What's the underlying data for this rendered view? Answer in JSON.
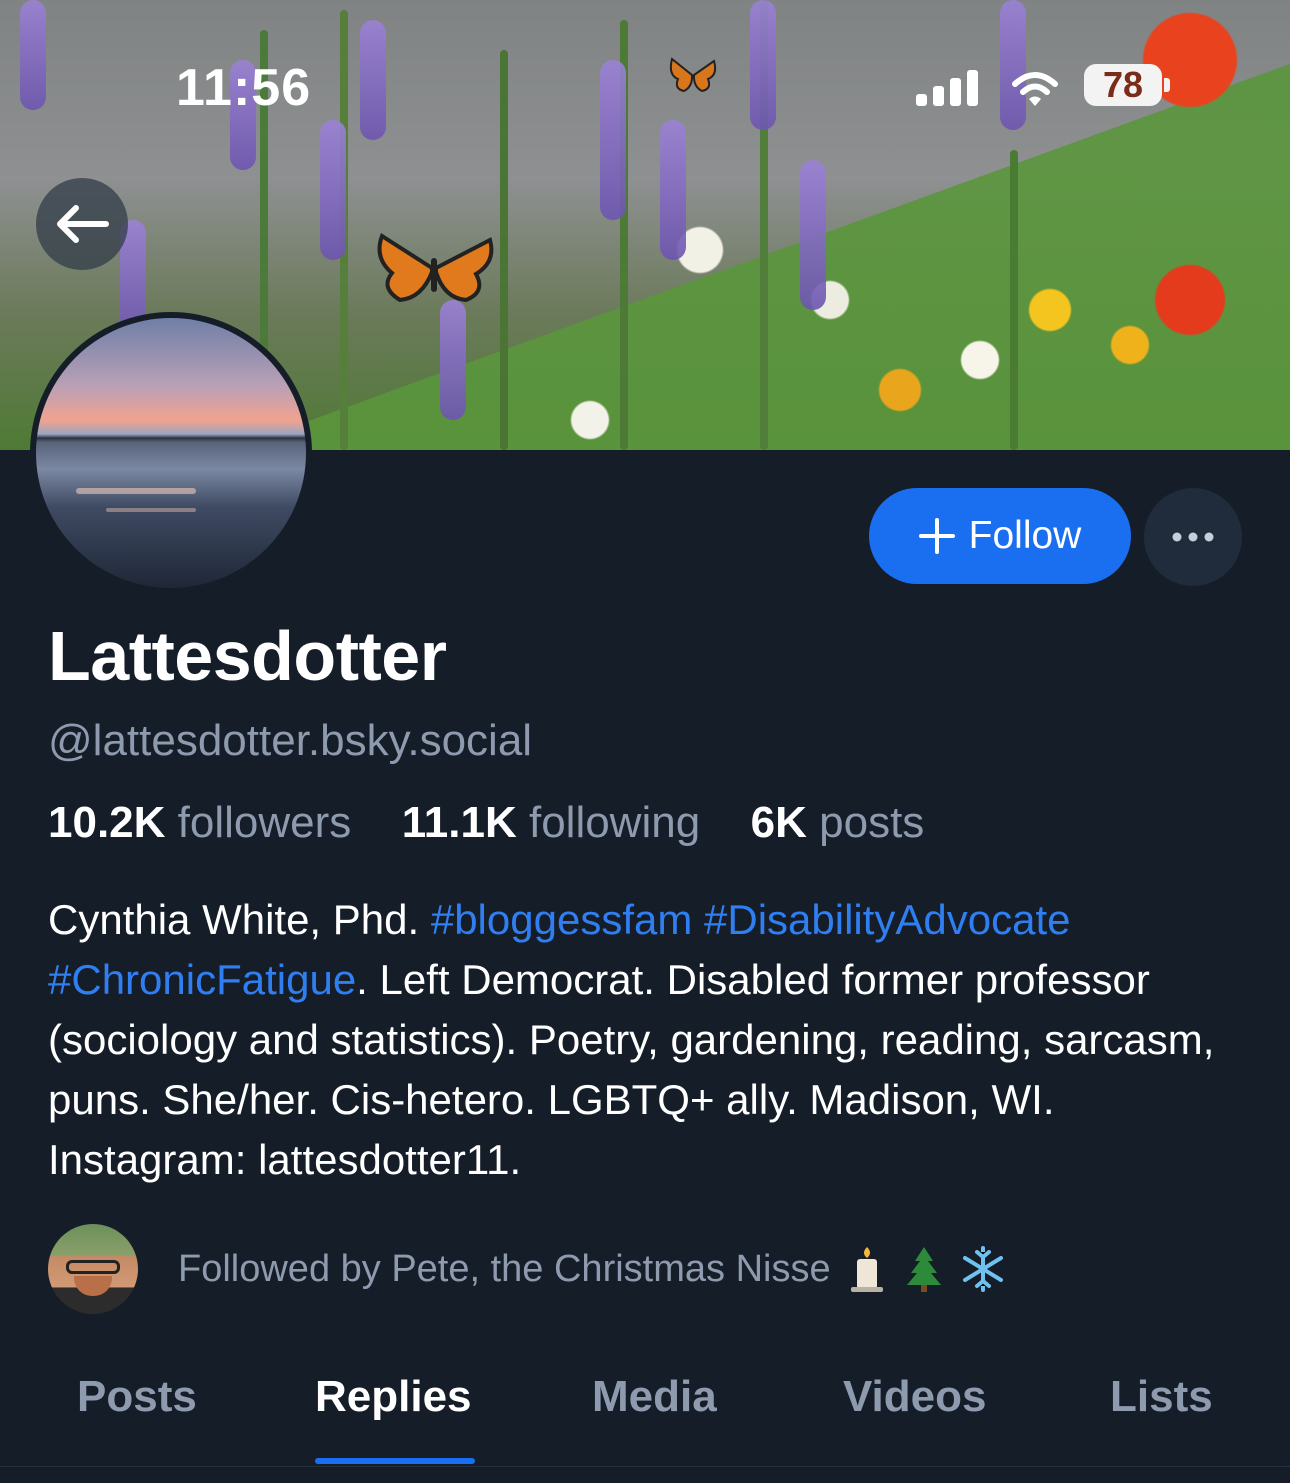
{
  "status_bar": {
    "time": "11:56",
    "battery": "78",
    "icons": [
      "signal-icon",
      "wifi-icon",
      "battery-icon"
    ]
  },
  "profile": {
    "display_name": "Lattesdotter",
    "handle": "@lattesdotter.bsky.social",
    "follow_label": "Follow",
    "stats": {
      "followers_count": "10.2K",
      "followers_label": "followers",
      "following_count": "11.1K",
      "following_label": "following",
      "posts_count": "6K",
      "posts_label": "posts"
    },
    "bio": {
      "part1": "Cynthia White, Phd. ",
      "tag1": "#bloggessfam",
      "tag2": "#DisabilityAdvocate",
      "tag3": "#ChronicFatigue",
      "part2": ". Left Democrat. Disabled former professor (sociology and statistics). Poetry, gardening, reading, sarcasm, puns. She/her. Cis-hetero. LGBTQ+ ally. Madison, WI. Instagram: lattesdotter11."
    },
    "followed_by": {
      "text": "Followed by Pete, the Christmas Nisse",
      "emojis": [
        "candle-icon",
        "tree-icon",
        "snowflake-icon"
      ]
    }
  },
  "tabs": [
    {
      "label": "Posts"
    },
    {
      "label": "Replies"
    },
    {
      "label": "Media"
    },
    {
      "label": "Videos"
    },
    {
      "label": "Lists"
    }
  ],
  "active_tab": "Replies",
  "colors": {
    "background": "#151d28",
    "accent": "#1a6ff0",
    "hashtag": "#2f7ff2",
    "muted_text": "#8e9aae"
  }
}
